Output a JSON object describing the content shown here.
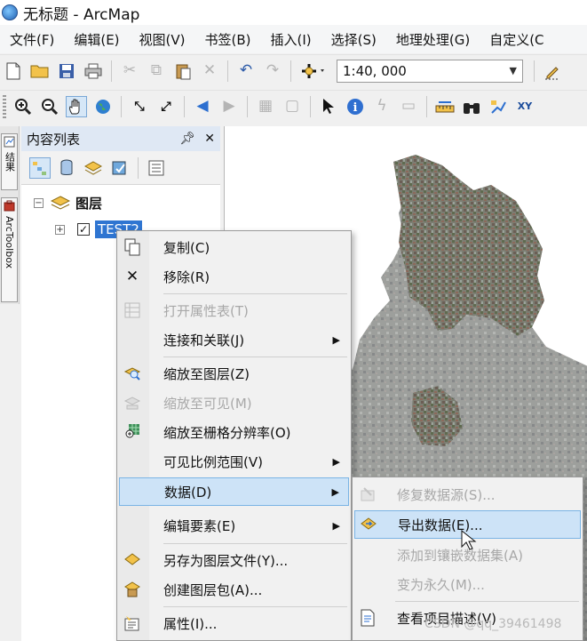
{
  "window": {
    "title": "无标题 - ArcMap"
  },
  "menubar": {
    "items": [
      "文件(F)",
      "编辑(E)",
      "视图(V)",
      "书签(B)",
      "插入(I)",
      "选择(S)",
      "地理处理(G)",
      "自定义(C"
    ]
  },
  "toolbar": {
    "scale_value": "1:40, 000"
  },
  "side_tabs": {
    "results": "结果",
    "toolbox": "ArcToolbox"
  },
  "toc": {
    "title": "内容列表",
    "pin_glyph": "ㅁ",
    "close_glyph": "✕",
    "layers_group": "图层",
    "layer_name": "TEST2"
  },
  "context_menu": {
    "items": [
      {
        "label": "复制(C)",
        "icon": "copy-icon",
        "enabled": true
      },
      {
        "label": "移除(R)",
        "icon": "remove-icon",
        "enabled": true
      },
      {
        "label": "打开属性表(T)",
        "icon": "table-icon",
        "enabled": false
      },
      {
        "label": "连接和关联(J)",
        "icon": "",
        "enabled": true,
        "submenu": true
      },
      {
        "label": "缩放至图层(Z)",
        "icon": "zoom-to-layer-icon",
        "enabled": true
      },
      {
        "label": "缩放至可见(M)",
        "icon": "zoom-visible-icon",
        "enabled": false
      },
      {
        "label": "缩放至栅格分辨率(O)",
        "icon": "zoom-raster-icon",
        "enabled": true
      },
      {
        "label": "可见比例范围(V)",
        "icon": "",
        "enabled": true,
        "submenu": true
      },
      {
        "label": "数据(D)",
        "icon": "",
        "enabled": true,
        "submenu": true,
        "highlighted": true
      },
      {
        "label": "编辑要素(E)",
        "icon": "",
        "enabled": true,
        "submenu": true
      },
      {
        "label": "另存为图层文件(Y)...",
        "icon": "layer-file-icon",
        "enabled": true
      },
      {
        "label": "创建图层包(A)...",
        "icon": "layer-package-icon",
        "enabled": true
      },
      {
        "label": "属性(I)...",
        "icon": "properties-icon",
        "enabled": true
      }
    ]
  },
  "data_submenu": {
    "items": [
      {
        "label": "修复数据源(S)...",
        "icon": "repair-source-icon",
        "enabled": false
      },
      {
        "label": "导出数据(E)...",
        "icon": "export-data-icon",
        "enabled": true,
        "highlighted": true
      },
      {
        "label": "添加到镶嵌数据集(A)",
        "icon": "",
        "enabled": false
      },
      {
        "label": "变为永久(M)...",
        "icon": "",
        "enabled": false
      },
      {
        "label": "查看项目描述(V)",
        "icon": "item-description-icon",
        "enabled": true
      }
    ]
  },
  "watermark": "CSDN @qq_39461498"
}
